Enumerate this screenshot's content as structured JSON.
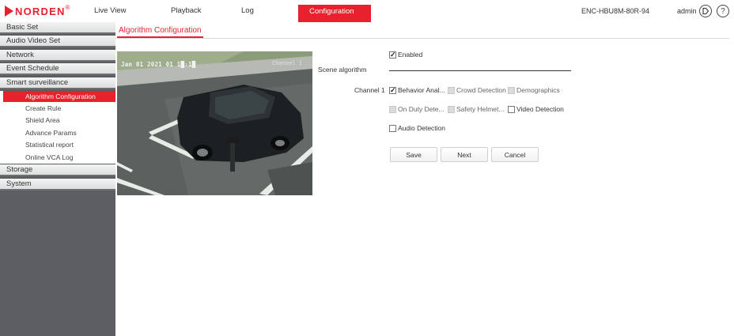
{
  "header": {
    "brand": "NORDEN",
    "brand_mark": "®",
    "nav": {
      "live_view": "Live View",
      "playback": "Playback",
      "log": "Log",
      "configuration": "Configuration"
    },
    "device_name": "ENC-HBU8M-80R-94",
    "user": "admin",
    "logout_glyph": "⇥",
    "help_glyph": "?"
  },
  "sidebar": {
    "menus": {
      "basic_set": "Basic Set",
      "audio_video_set": "Audio Video Set",
      "network": "Network",
      "event_schedule": "Event Schedule",
      "smart_surveillance": "Smart surveillance",
      "storage": "Storage",
      "system": "System"
    },
    "smart_items": {
      "algorithm_configuration": "Algorithm Configuration",
      "create_rule": "Create Rule",
      "shield_area": "Shield Area",
      "advance_params": "Advance Params",
      "statistical_report": "Statistical report",
      "online_vca_log": "Online VCA Log"
    }
  },
  "page": {
    "tab": "Algorithm Configuration"
  },
  "video": {
    "osd_time": "Jan 01 2021 01 1█:1█",
    "osd_channel": "Channel 1"
  },
  "form": {
    "enabled_label": "Enabled",
    "enabled_checked": true,
    "scene_label": "Scene algorithm",
    "channel_label": "Channel 1",
    "algorithms": {
      "behavior": {
        "label": "Behavior Anal...",
        "checked": true,
        "disabled": false
      },
      "crowd": {
        "label": "Crowd Detection",
        "checked": false,
        "disabled": true
      },
      "demographics": {
        "label": "Demographics",
        "checked": false,
        "disabled": true
      },
      "on_duty": {
        "label": "On Duty Dete...",
        "checked": false,
        "disabled": true
      },
      "safety_helmet": {
        "label": "Safety Helmet...",
        "checked": false,
        "disabled": true
      },
      "video_detection": {
        "label": "Video Detection",
        "checked": false,
        "disabled": false
      },
      "audio_detection": {
        "label": "Audio Detection",
        "checked": false,
        "disabled": false
      }
    },
    "buttons": {
      "save": "Save",
      "next": "Next",
      "cancel": "Cancel"
    }
  },
  "colors": {
    "accent": "#e8212e",
    "sidebar_bg": "#5c5e61"
  }
}
